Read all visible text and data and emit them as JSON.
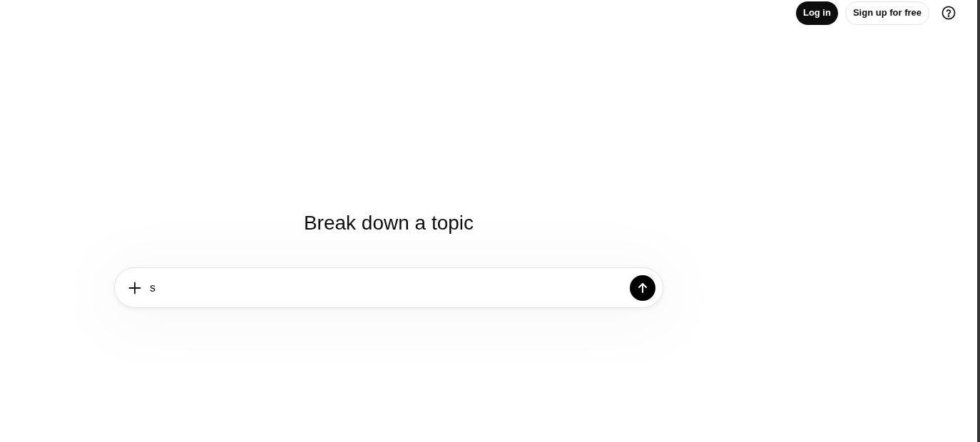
{
  "header": {
    "buttons": [
      {
        "kind": "primary",
        "label": "Log in"
      },
      {
        "kind": "secondary",
        "label": "Sign up for free"
      }
    ]
  },
  "main": {
    "heading": "Break down a topic",
    "composer": {
      "value": "s"
    }
  }
}
